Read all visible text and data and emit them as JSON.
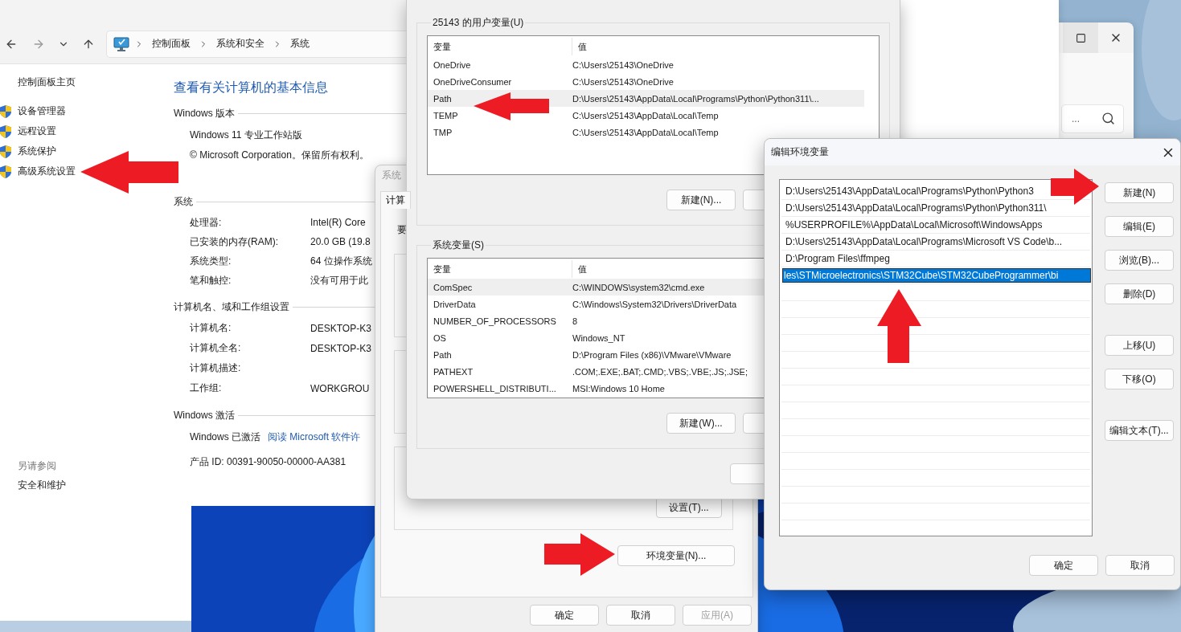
{
  "control_panel": {
    "breadcrumb": [
      "控制面板",
      "系统和安全",
      "系统"
    ],
    "sidebar": {
      "home": "控制面板主页",
      "items": [
        "设备管理器",
        "远程设置",
        "系统保护",
        "高级系统设置"
      ],
      "see_also_title": "另请参阅",
      "see_also": [
        "安全和维护"
      ]
    },
    "title": "查看有关计算机的基本信息",
    "sections": [
      {
        "kind": "text",
        "heading": "Windows 版本",
        "lines": [
          "Windows 11 专业工作站版",
          "© Microsoft Corporation。保留所有权利。"
        ]
      },
      {
        "kind": "table",
        "heading": "系统",
        "rows": [
          {
            "label": "处理器:",
            "value": "Intel(R) Core"
          },
          {
            "label": "已安装的内存(RAM):",
            "value": "20.0 GB (19.8"
          },
          {
            "label": "系统类型:",
            "value": "64 位操作系统"
          },
          {
            "label": "笔和触控:",
            "value": "没有可用于此"
          }
        ]
      },
      {
        "kind": "table",
        "heading": "计算机名、域和工作组设置",
        "rows": [
          {
            "label": "计算机名:",
            "value": "DESKTOP-K3"
          },
          {
            "label": "计算机全名:",
            "value": "DESKTOP-K3"
          },
          {
            "label": "计算机描述:"
          },
          {
            "label": "工作组:",
            "value": "WORKGROU"
          }
        ]
      },
      {
        "kind": "activation",
        "heading": "Windows 激活",
        "status": "Windows 已激活",
        "link": "阅读 Microsoft 软件许",
        "product_id": "产品 ID: 00391-90050-00000-AA381"
      }
    ]
  },
  "settings_window": {
    "search": {
      "placeholder": "..."
    }
  },
  "system_properties": {
    "title": "系统",
    "tab": {
      "label": "计算",
      "selected": true
    },
    "intro": "要",
    "settings_button": "设置(T)...",
    "env_button": "环境变量(N)...",
    "buttons": [
      {
        "label": "确定",
        "disabled": false
      },
      {
        "label": "取消",
        "disabled": false
      },
      {
        "label": "应用(A)",
        "disabled": true
      }
    ]
  },
  "env_vars": {
    "user": {
      "title": "25143 的用户变量(U)",
      "columns": [
        "变量",
        "值"
      ],
      "rows": [
        {
          "name": "OneDrive",
          "value": "C:\\Users\\25143\\OneDrive",
          "selected": false
        },
        {
          "name": "OneDriveConsumer",
          "value": "C:\\Users\\25143\\OneDrive",
          "selected": false
        },
        {
          "name": "Path",
          "value": "D:\\Users\\25143\\AppData\\Local\\Programs\\Python\\Python311\\...",
          "selected": true
        },
        {
          "name": "TEMP",
          "value": "C:\\Users\\25143\\AppData\\Local\\Temp",
          "selected": false
        },
        {
          "name": "TMP",
          "value": "C:\\Users\\25143\\AppData\\Local\\Temp",
          "selected": false
        }
      ],
      "buttons": [
        "新建(N)..."
      ]
    },
    "system": {
      "title": "系统变量(S)",
      "columns": [
        "变量",
        "值"
      ],
      "rows": [
        {
          "name": "ComSpec",
          "value": "C:\\WINDOWS\\system32\\cmd.exe",
          "selected": true
        },
        {
          "name": "DriverData",
          "value": "C:\\Windows\\System32\\Drivers\\DriverData",
          "selected": false
        },
        {
          "name": "NUMBER_OF_PROCESSORS",
          "value": "8",
          "selected": false
        },
        {
          "name": "OS",
          "value": "Windows_NT",
          "selected": false
        },
        {
          "name": "Path",
          "value": "D:\\Program Files (x86)\\VMware\\VMware",
          "selected": false
        },
        {
          "name": "PATHEXT",
          "value": ".COM;.EXE;.BAT;.CMD;.VBS;.VBE;.JS;.JSE;",
          "selected": false
        },
        {
          "name": "POWERSHELL_DISTRIBUTI...",
          "value": "MSI:Windows 10 Home",
          "selected": false
        }
      ],
      "buttons": [
        "新建(W)..."
      ]
    }
  },
  "edit_env_var": {
    "title": "编辑环境变量",
    "items": [
      {
        "text": "D:\\Users\\25143\\AppData\\Local\\Programs\\Python\\Python3",
        "selected": false
      },
      {
        "text": "D:\\Users\\25143\\AppData\\Local\\Programs\\Python\\Python311\\",
        "selected": false
      },
      {
        "text": "%USERPROFILE%\\AppData\\Local\\Microsoft\\WindowsApps",
        "selected": false
      },
      {
        "text": "D:\\Users\\25143\\AppData\\Local\\Programs\\Microsoft VS Code\\b...",
        "selected": false
      },
      {
        "text": "D:\\Program Files\\ffmpeg",
        "selected": false
      },
      {
        "text": "les\\STMicroelectronics\\STM32Cube\\STM32CubeProgrammer\\bi",
        "selected": true
      }
    ],
    "button_groups": [
      [
        "新建(N)",
        "编辑(E)",
        "浏览(B)...",
        "删除(D)"
      ],
      [
        "上移(U)",
        "下移(O)"
      ],
      [
        "编辑文本(T)..."
      ]
    ],
    "buttons": [
      "确定",
      "取消"
    ]
  }
}
